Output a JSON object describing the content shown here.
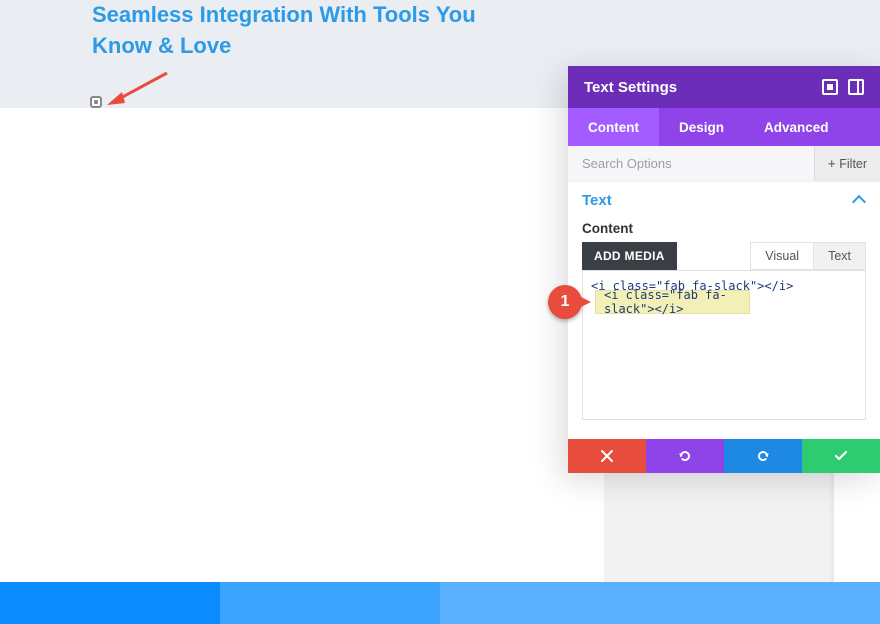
{
  "page": {
    "heading": "Seamless Integration With Tools You Know & Love"
  },
  "panel": {
    "title": "Text Settings",
    "tabs": {
      "content": "Content",
      "design": "Design",
      "advanced": "Advanced"
    },
    "search_placeholder": "Search Options",
    "filter_label": "Filter",
    "section_title": "Text",
    "content_label": "Content",
    "add_media": "ADD MEDIA",
    "view_tabs": {
      "visual": "Visual",
      "text": "Text"
    },
    "editor_value": "<i class=\"fab fa-slack\"></i>"
  },
  "callout": {
    "number": "1"
  }
}
